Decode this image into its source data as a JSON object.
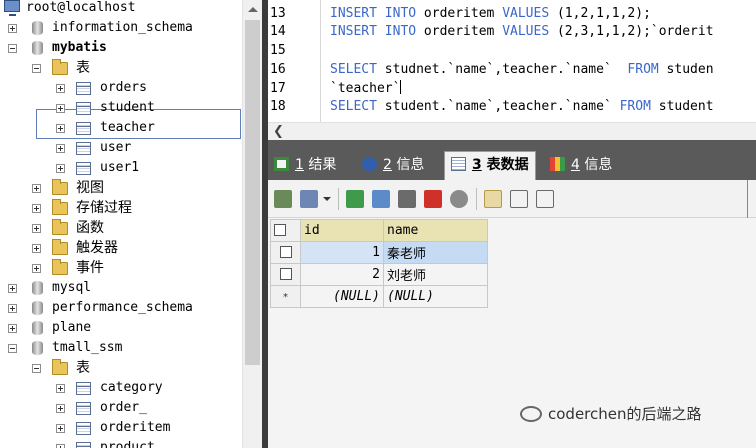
{
  "tree": {
    "host": "root@localhost",
    "databases": [
      {
        "name": "information_schema",
        "bold": false
      },
      {
        "name": "mybatis",
        "bold": true
      },
      {
        "name": "mysql",
        "bold": false
      },
      {
        "name": "performance_schema",
        "bold": false
      },
      {
        "name": "plane",
        "bold": false
      },
      {
        "name": "tmall_ssm",
        "bold": false
      }
    ],
    "mybatis_children": {
      "tables_folder": "表",
      "tables": [
        "orders",
        "student",
        "teacher",
        "user",
        "user1"
      ],
      "other_folders": [
        "视图",
        "存储过程",
        "函数",
        "触发器",
        "事件"
      ]
    },
    "tmall_children": {
      "tables_folder": "表",
      "tables": [
        "category",
        "order_",
        "orderitem",
        "product"
      ]
    }
  },
  "editor": {
    "line_numbers": [
      "13",
      "14",
      "15",
      "16",
      "17",
      "18"
    ],
    "lines": [
      {
        "kw1": "INSERT INTO",
        "t1": " orderitem ",
        "kw2": "VALUES",
        "t2": " (1,2,1,1,2);"
      },
      {
        "kw1": "INSERT INTO",
        "t1": " orderitem ",
        "kw2": "VALUES",
        "t2": " (2,3,1,1,2);`orderit"
      },
      {
        "kw1": "",
        "t1": "",
        "kw2": "",
        "t2": ""
      },
      {
        "kw1": "SELECT",
        "t1": " studnet.`name`,teacher.`name`  ",
        "kw2": "FROM",
        "t2": " studen"
      },
      {
        "kw1": "",
        "t1": "`teacher`",
        "kw2": "",
        "t2": ""
      },
      {
        "kw1": "SELECT",
        "t1": " student.`name`,teacher.`name` ",
        "kw2": "FROM",
        "t2": " student"
      }
    ]
  },
  "tabs": [
    {
      "num": "1",
      "label": "结果"
    },
    {
      "num": "2",
      "label": "信息"
    },
    {
      "num": "3",
      "label": "表数据"
    },
    {
      "num": "4",
      "label": "信息"
    }
  ],
  "result_grid": {
    "columns": [
      "id",
      "name"
    ],
    "rows": [
      {
        "id": "1",
        "name": "秦老师"
      },
      {
        "id": "2",
        "name": "刘老师"
      }
    ],
    "new_row": {
      "id": "(NULL)",
      "name": "(NULL)"
    },
    "new_row_marker": "*"
  },
  "watermark": "coderchen的后端之路",
  "colors": {
    "keyword": "#3a67c9",
    "tab_bar": "#5a5a5a",
    "selection_border": "#5f7fb7",
    "header_highlight": "#e9e2b2"
  }
}
